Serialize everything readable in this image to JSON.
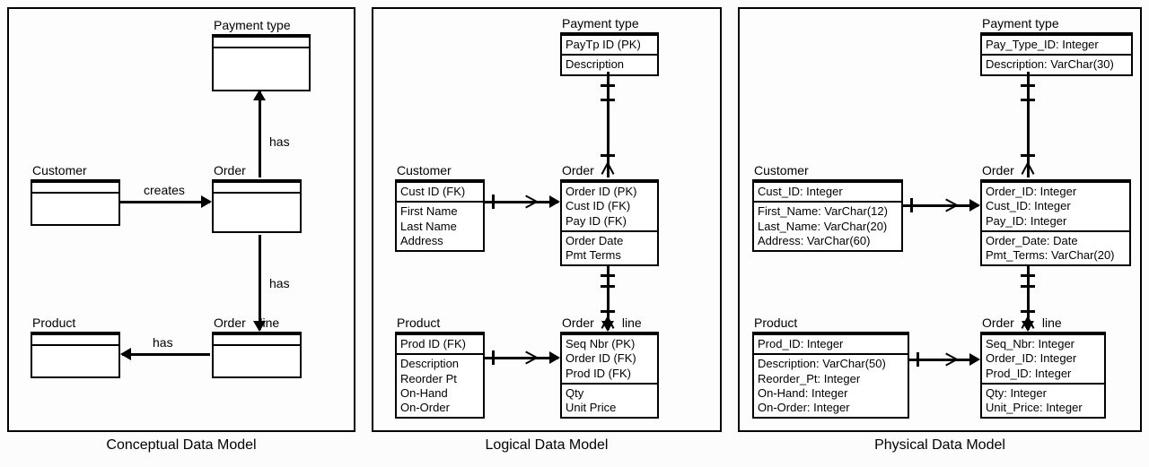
{
  "captions": {
    "conceptual": "Conceptual Data Model",
    "logical": "Logical Data Model",
    "physical": "Physical Data Model"
  },
  "conceptual": {
    "payment": "Payment type",
    "customer": "Customer",
    "order": "Order",
    "orderline": "Order    line",
    "product": "Product",
    "rel_creates": "creates",
    "rel_has1": "has",
    "rel_has2": "has",
    "rel_has3": "has"
  },
  "logical": {
    "payment": {
      "title": "Payment type",
      "pk": "PayTp ID (PK)",
      "a1": "Description"
    },
    "customer": {
      "title": "Customer",
      "pk": "Cust ID (FK)",
      "a1": "First Name",
      "a2": "Last Name",
      "a3": "Address"
    },
    "order": {
      "title": "Order",
      "pk": "Order ID (PK)",
      "fk1": "Cust ID (FK)",
      "fk2": "Pay ID (FK)",
      "a1": "Order Date",
      "a2": "Pmt Terms"
    },
    "orderline": {
      "title": "Order        line",
      "pk": "Seq Nbr (PK)",
      "fk1": "Order ID (FK)",
      "fk2": "Prod ID (FK)",
      "a1": "Qty",
      "a2": "Unit Price"
    },
    "product": {
      "title": "Product",
      "pk": "Prod ID (FK)",
      "a1": "Description",
      "a2": "Reorder Pt",
      "a3": "On-Hand",
      "a4": "On-Order"
    }
  },
  "physical": {
    "payment": {
      "title": "Payment type",
      "pk": "Pay_Type_ID: Integer",
      "a1": "Description: VarChar(30)"
    },
    "customer": {
      "title": "Customer",
      "pk": "Cust_ID: Integer",
      "a1": "First_Name: VarChar(12)",
      "a2": "Last_Name: VarChar(20)",
      "a3": "Address: VarChar(60)"
    },
    "order": {
      "title": "Order",
      "pk": "Order_ID: Integer",
      "fk1": "Cust_ID: Integer",
      "fk2": "Pay_ID: Integer",
      "a1": "Order_Date: Date",
      "a2": "Pmt_Terms: VarChar(20)"
    },
    "orderline": {
      "title": "Order        line",
      "pk": "Seq_Nbr: Integer",
      "fk1": "Order_ID: Integer",
      "fk2": "Prod_ID: Integer",
      "a1": "Qty: Integer",
      "a2": "Unit_Price: Integer"
    },
    "product": {
      "title": "Product",
      "pk": "Prod_ID: Integer",
      "a1": "Description: VarChar(50)",
      "a2": "Reorder_Pt: Integer",
      "a3": "On-Hand: Integer",
      "a4": "On-Order: Integer"
    }
  }
}
